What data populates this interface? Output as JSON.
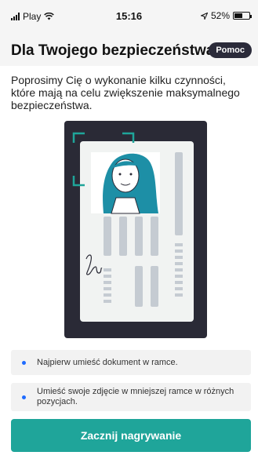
{
  "status_bar": {
    "carrier": "Play",
    "time": "15:16",
    "battery": "52%"
  },
  "header": {
    "title": "Dla Twojego bezpieczeństwa",
    "help_label": "Pomoc"
  },
  "intro_text": "Poprosimy Cię o wykonanie kilku czynności, które mają na celu zwiększenie maksymalnego bezpieczeństwa.",
  "instructions": [
    {
      "text": "Najpierw umieść dokument w ramce."
    },
    {
      "text": "Umieść swoje zdjęcie w mniejszej ramce w różnych pozycjach."
    }
  ],
  "start_button": "Zacznij nagrywanie",
  "colors": {
    "accent": "#1fa59a",
    "dot": "#1e6bff",
    "help_bg": "#2b2b3a",
    "frame": "#2a2a36"
  },
  "icons": [
    "signal-icon",
    "wifi-icon",
    "location-arrow-icon",
    "battery-icon"
  ]
}
